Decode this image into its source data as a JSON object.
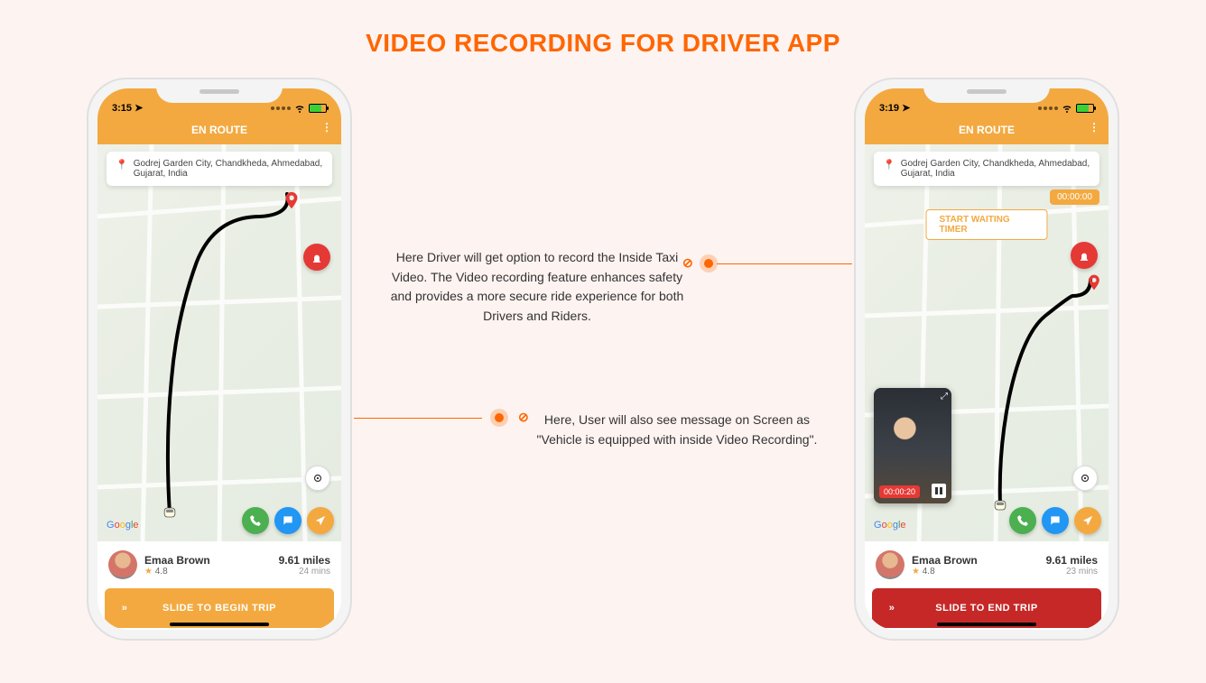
{
  "title": "VIDEO RECORDING FOR DRIVER APP",
  "annotations": {
    "top": "Here Driver will get option to record the Inside Taxi Video. The Video recording feature enhances safety and provides a more secure ride experience for both Drivers and Riders.",
    "bottom": "Here, User will also see message on Screen as \"Vehicle is equipped with inside Video Recording\"."
  },
  "phoneLeft": {
    "time": "3:15",
    "header": "EN ROUTE",
    "address": "Godrej Garden City, Chandkheda, Ahmedabad, Gujarat, India",
    "rider": {
      "name": "Emaa Brown",
      "rating": "4.8"
    },
    "distance": "9.61 miles",
    "eta": "24 mins",
    "slider": "SLIDE TO BEGIN TRIP"
  },
  "phoneRight": {
    "time": "3:19",
    "header": "EN ROUTE",
    "address": "Godrej Garden City, Chandkheda, Ahmedabad, Gujarat, India",
    "timerBadge": "00:00:00",
    "waitButton": "START WAITING TIMER",
    "recTime": "00:00:20",
    "rider": {
      "name": "Emaa Brown",
      "rating": "4.8"
    },
    "distance": "9.61 miles",
    "eta": "23 mins",
    "slider": "SLIDE TO END TRIP"
  },
  "icons": {
    "google": "Google"
  }
}
